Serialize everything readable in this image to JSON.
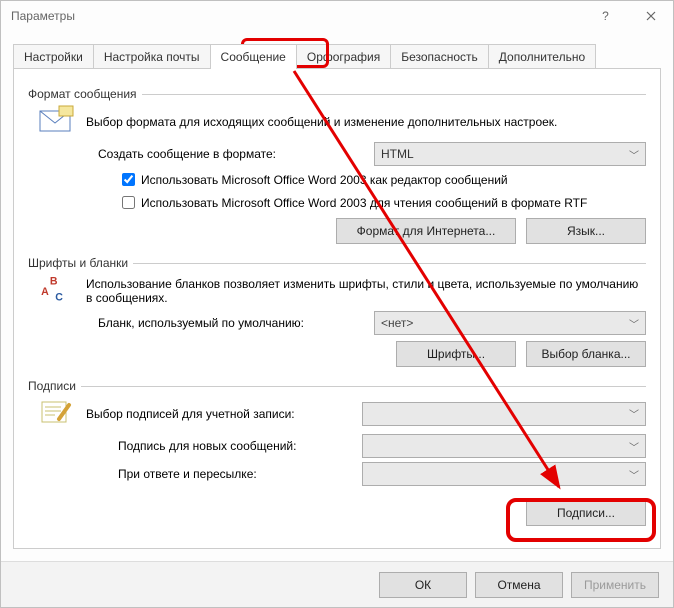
{
  "window": {
    "title": "Параметры"
  },
  "tabs": {
    "items": [
      {
        "label": "Настройки"
      },
      {
        "label": "Настройка почты"
      },
      {
        "label": "Сообщение"
      },
      {
        "label": "Орфография"
      },
      {
        "label": "Безопасность"
      },
      {
        "label": "Дополнительно"
      }
    ],
    "active_index": 2
  },
  "format": {
    "legend": "Формат сообщения",
    "desc": "Выбор формата для исходящих сообщений и изменение дополнительных настроек.",
    "format_label": "Создать сообщение в формате:",
    "format_value": "HTML",
    "cb1": "Использовать Microsoft Office Word 2003 как редактор сообщений",
    "cb2": "Использовать Microsoft Office Word 2003 для чтения сообщений в формате RTF",
    "btn_internet": "Формат для Интернета...",
    "btn_lang": "Язык..."
  },
  "fonts": {
    "legend": "Шрифты и бланки",
    "desc": "Использование бланков позволяет изменить шрифты, стили и цвета, используемые по умолчанию в сообщениях.",
    "blank_label": "Бланк, используемый по умолчанию:",
    "blank_value": "<нет>",
    "btn_fonts": "Шрифты...",
    "btn_blank": "Выбор бланка..."
  },
  "sigs": {
    "legend": "Подписи",
    "desc": "Выбор подписей для учетной записи:",
    "new_label": "Подпись для новых сообщений:",
    "reply_label": "При ответе и пересылке:",
    "btn_sig": "Подписи..."
  },
  "footer": {
    "ok": "ОК",
    "cancel": "Отмена",
    "apply": "Применить"
  }
}
